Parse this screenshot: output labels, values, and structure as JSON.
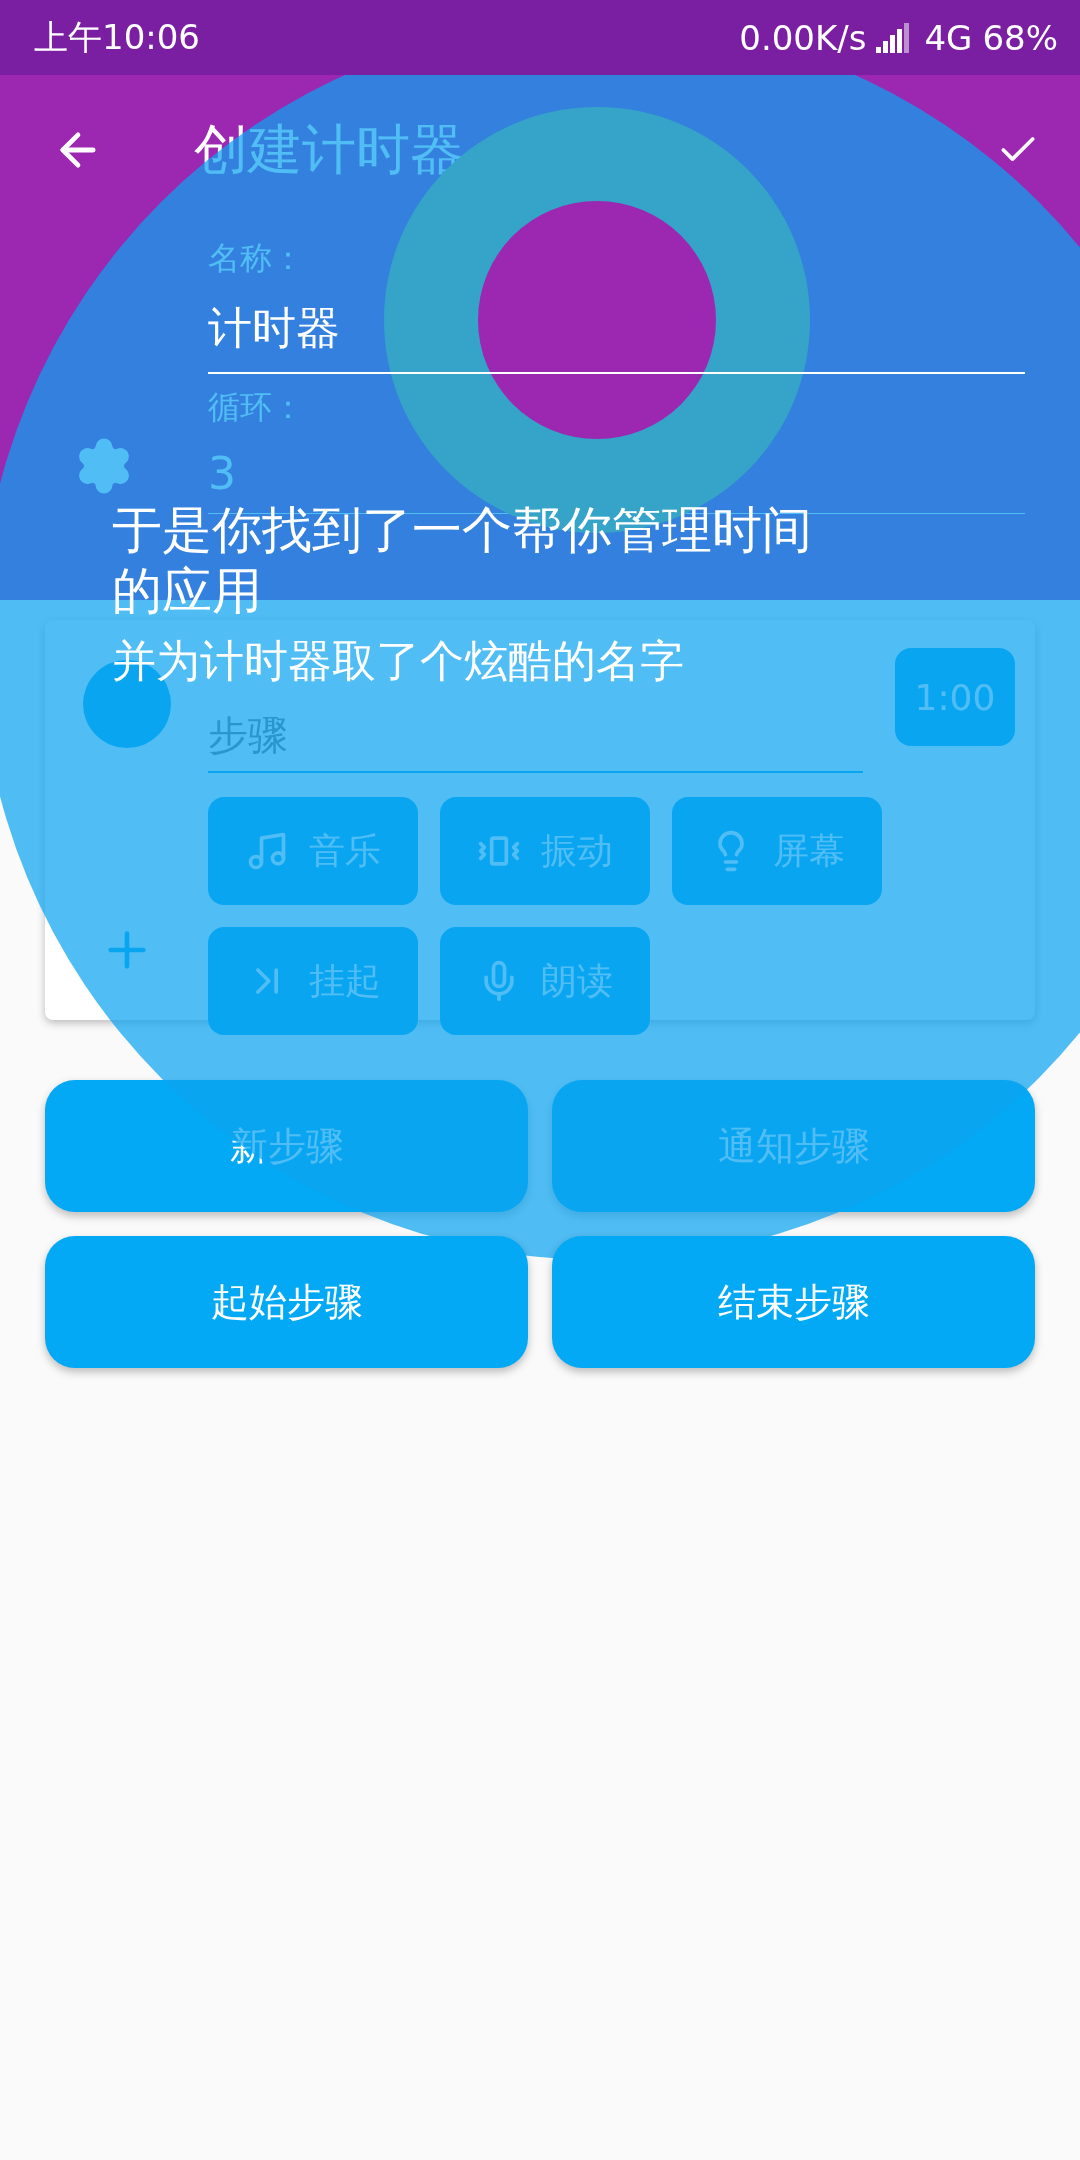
{
  "status_bar": {
    "time": "上午10:06",
    "network_speed": "0.00K/s",
    "network_type": "4G",
    "battery": "68%"
  },
  "app_bar": {
    "title": "创建计时器"
  },
  "form": {
    "name": {
      "label": "名称：",
      "value": "计时器"
    },
    "loop": {
      "label": "循环：",
      "value": "3"
    }
  },
  "step_card": {
    "name_placeholder": "步骤",
    "duration": "1:00",
    "actions": [
      {
        "label": "音乐"
      },
      {
        "label": "振动"
      },
      {
        "label": "屏幕"
      },
      {
        "label": "挂起"
      },
      {
        "label": "朗读"
      }
    ]
  },
  "buttons": [
    {
      "label": "新步骤"
    },
    {
      "label": "通知步骤"
    },
    {
      "label": "起始步骤"
    },
    {
      "label": "结束步骤"
    }
  ],
  "tutorial": {
    "title": "于是你找到了一个帮你管理时间的应用",
    "subtitle": "并为计时器取了个炫酷的名字"
  }
}
